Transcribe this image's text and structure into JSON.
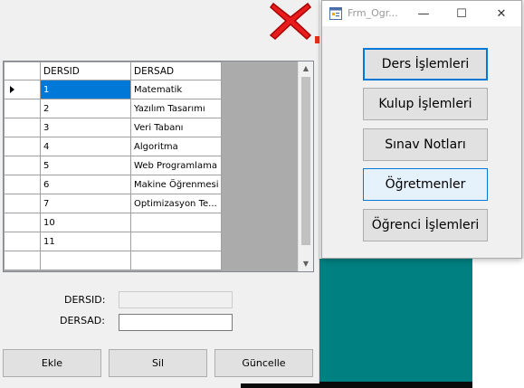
{
  "grid": {
    "columns": [
      "DERSID",
      "DERSAD"
    ],
    "rows": [
      {
        "id": "1",
        "name": "Matematik",
        "current": true
      },
      {
        "id": "2",
        "name": "Yazılım Tasarımı"
      },
      {
        "id": "3",
        "name": "Veri Tabanı"
      },
      {
        "id": "4",
        "name": "Algoritma"
      },
      {
        "id": "5",
        "name": "Web Programlama"
      },
      {
        "id": "6",
        "name": "Makine Öğrenmesi"
      },
      {
        "id": "7",
        "name": "Optimizasyon Te..."
      },
      {
        "id": "10",
        "name": ""
      },
      {
        "id": "11",
        "name": ""
      },
      {
        "id": "",
        "name": ""
      }
    ]
  },
  "form": {
    "dersid_label": "DERSID:",
    "dersad_label": "DERSAD:",
    "dersid_value": "",
    "dersad_value": ""
  },
  "buttons": {
    "add": "Ekle",
    "delete": "Sil",
    "update": "Güncelle"
  },
  "menu_window": {
    "title": "Frm_Ogr...",
    "minimize_glyph": "—",
    "maximize_glyph": "☐",
    "close_glyph": "✕",
    "items": [
      "Ders İşlemleri",
      "Kulup İşlemleri",
      "Sınav Notları",
      "Öğretmenler",
      "Öğrenci İşlemleri"
    ]
  },
  "colors": {
    "selection": "#0078d7",
    "teal_background": "#008080",
    "close_x": "#e81c1c"
  },
  "icons": {
    "red_x": "close-x-icon",
    "row_pointer": "current-row-arrow-icon",
    "app": "form-icon"
  }
}
